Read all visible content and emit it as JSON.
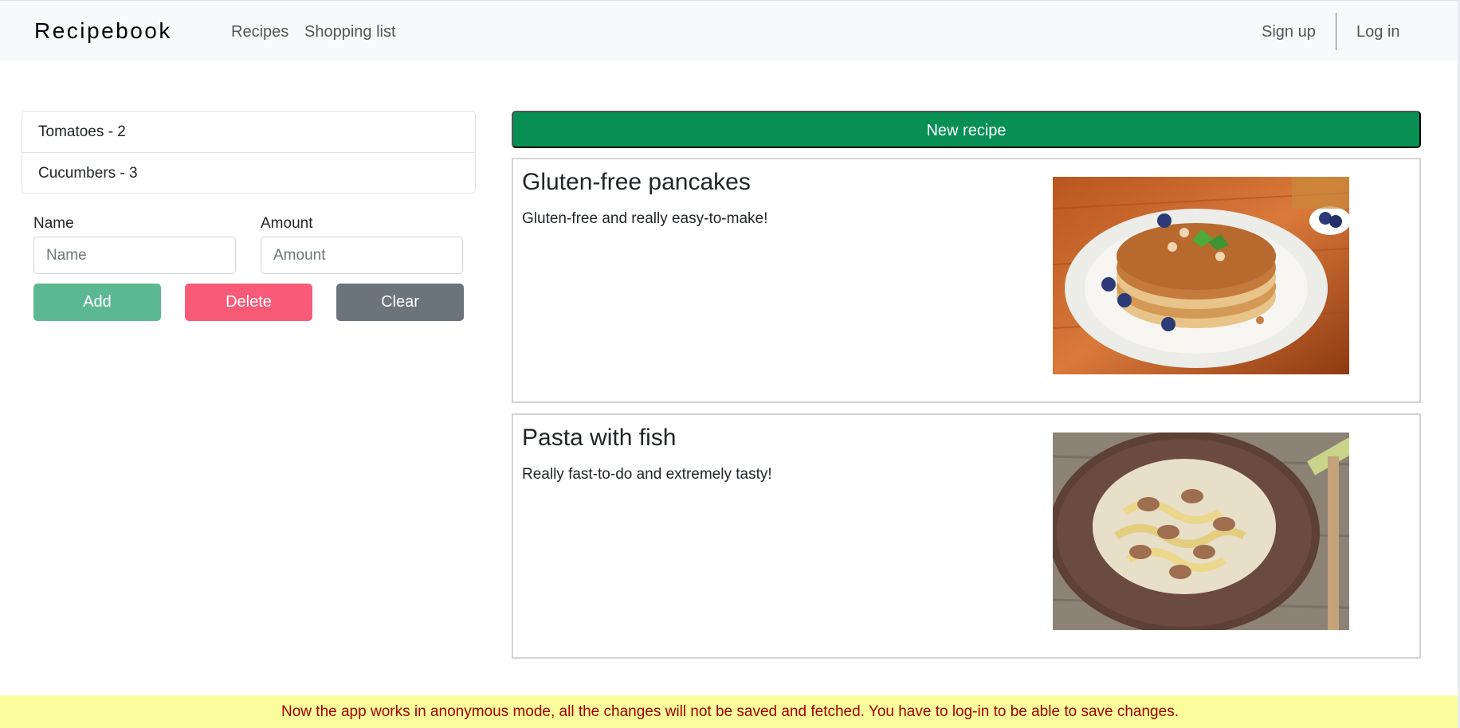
{
  "navbar": {
    "brand": "Recipebook",
    "links": [
      "Recipes",
      "Shopping list"
    ],
    "signup": "Sign up",
    "login": "Log in"
  },
  "shopping_list": {
    "items": [
      "Tomatoes - 2",
      "Cucumbers - 3"
    ],
    "name_label": "Name",
    "name_placeholder": "Name",
    "amount_label": "Amount",
    "amount_placeholder": "Amount",
    "add_label": "Add",
    "delete_label": "Delete",
    "clear_label": "Clear"
  },
  "recipes": {
    "new_label": "New recipe",
    "items": [
      {
        "title": "Gluten-free pancakes",
        "description": "Gluten-free and really easy-to-make!",
        "image": "pancakes-photo"
      },
      {
        "title": "Pasta with fish",
        "description": "Really fast-to-do and extremely tasty!",
        "image": "pasta-photo"
      }
    ]
  },
  "banner": {
    "text": "Now the app works in anonymous mode, all the changes will not be saved and fetched. You have to log-in to be able to save changes."
  },
  "colors": {
    "add": "#5cb893",
    "delete": "#f85a78",
    "clear": "#6b737c",
    "new_recipe": "#078f54",
    "banner_bg": "#fbfd9d",
    "banner_text": "#a30000"
  }
}
